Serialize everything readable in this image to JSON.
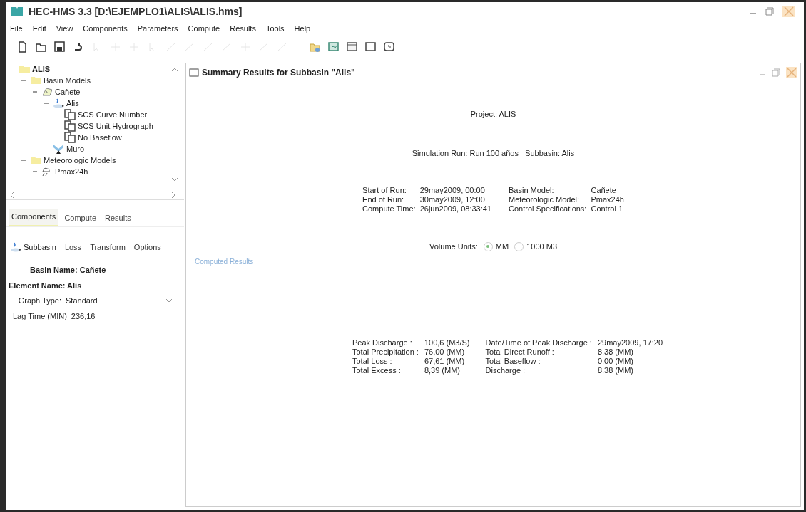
{
  "window": {
    "title": "HEC-HMS 3.3 [D:\\EJEMPLO1\\ALIS\\ALIS.hms]"
  },
  "menu": [
    "File",
    "Edit",
    "View",
    "Components",
    "Parameters",
    "Compute",
    "Results",
    "Tools",
    "Help"
  ],
  "toolbar": [
    {
      "kind": "new",
      "disabled": false
    },
    {
      "kind": "open",
      "disabled": false
    },
    {
      "kind": "save",
      "disabled": false
    },
    {
      "kind": "undo",
      "disabled": false
    },
    {
      "kind": "arrow",
      "disabled": true
    },
    {
      "kind": "plus",
      "disabled": true
    },
    {
      "kind": "plus",
      "disabled": true
    },
    {
      "kind": "arrow",
      "disabled": true
    },
    {
      "kind": "line",
      "disabled": true
    },
    {
      "kind": "line",
      "disabled": true
    },
    {
      "kind": "line",
      "disabled": true
    },
    {
      "kind": "line",
      "disabled": true
    },
    {
      "kind": "plus",
      "disabled": true
    },
    {
      "kind": "line",
      "disabled": true
    },
    {
      "kind": "line",
      "disabled": true
    },
    {
      "kind": "folder",
      "disabled": false
    },
    {
      "kind": "chart",
      "disabled": false
    },
    {
      "kind": "table",
      "disabled": false
    },
    {
      "kind": "box",
      "disabled": false
    },
    {
      "kind": "clock",
      "disabled": false
    }
  ],
  "tree": [
    {
      "label": "ALIS",
      "kind": "folder",
      "children": [
        {
          "label": "Basin Models",
          "kind": "folder",
          "expanded": true,
          "children": [
            {
              "label": "Cañete",
              "kind": "basin",
              "expanded": true,
              "children": [
                {
                  "label": "Alis",
                  "kind": "subbasin",
                  "expanded": true,
                  "children": [
                    {
                      "label": "SCS Curve Number",
                      "kind": "method"
                    },
                    {
                      "label": "SCS Unit Hydrograph",
                      "kind": "method"
                    },
                    {
                      "label": "No Baseflow",
                      "kind": "method"
                    }
                  ]
                },
                {
                  "label": "Muro",
                  "kind": "reservoir"
                }
              ]
            }
          ]
        },
        {
          "label": "Meteorologic Models",
          "kind": "folder",
          "expanded": true,
          "children": [
            {
              "label": "Pmax24h",
              "kind": "met",
              "expanded": true
            }
          ]
        }
      ]
    }
  ],
  "tabs": [
    {
      "label": "Components",
      "selected": true
    },
    {
      "label": "Compute",
      "selected": false
    },
    {
      "label": "Results",
      "selected": false
    }
  ],
  "subtabs": [
    {
      "label": "Subbasin",
      "selected": true
    },
    {
      "label": "Loss",
      "selected": false
    },
    {
      "label": "Transform",
      "selected": false
    },
    {
      "label": "Options",
      "selected": false
    }
  ],
  "properties": {
    "basin_name": "Basin Name: Cañete",
    "element_name": "Element Name: Alis",
    "graph_type_label": "Graph Type:",
    "graph_type": "Standard",
    "lag_time_label": "Lag Time (MIN)",
    "lag_time": "236,16"
  },
  "summary": {
    "title": "Summary Results for Subbasin \"Alis\"",
    "project": "Project: ALIS",
    "simulation": "Simulation Run: Run 100 años   Subbasin: Alis",
    "info": [
      [
        "Start of Run:",
        "29may2009, 00:00",
        "Basin Model:",
        "Cañete"
      ],
      [
        "End of Run:",
        "30may2009, 12:00",
        "Meteorologic Model:",
        "Pmax24h"
      ],
      [
        "Compute Time:",
        "26jun2009, 08:33:41",
        "Control Specifications:",
        "Control 1"
      ]
    ],
    "volume_units_label": "Volume Units:",
    "volume_units": [
      {
        "label": "MM",
        "selected": true
      },
      {
        "label": "1000 M3",
        "selected": false
      }
    ],
    "link": "Computed Results",
    "results": [
      [
        "Peak Discharge :",
        "100,6 (M3/S)",
        "Date/Time of Peak Discharge :",
        "29may2009, 17:20"
      ],
      [
        "Total Precipitation :",
        "76,00 (MM)",
        "Total Direct Runoff :",
        "8,38 (MM)"
      ],
      [
        "Total Loss :",
        "67,61 (MM)",
        "Total Baseflow :",
        "0,00 (MM)"
      ],
      [
        "Total Excess :",
        "8,39 (MM)",
        "Discharge :",
        "8,38 (MM)"
      ]
    ]
  }
}
